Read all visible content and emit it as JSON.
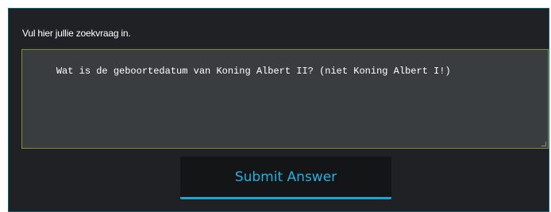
{
  "form": {
    "prompt_label": "Vul hier jullie zoekvraag in.",
    "answer_text": "Wat is de geboortedatum van Koning Albert II? (niet Koning Albert I!)",
    "submit_label": "Submit Answer"
  },
  "colors": {
    "panel_background": "#1f2124",
    "textarea_background": "#3a3d40",
    "textarea_border": "#7f8a3a",
    "accent": "#1fa3d1"
  }
}
